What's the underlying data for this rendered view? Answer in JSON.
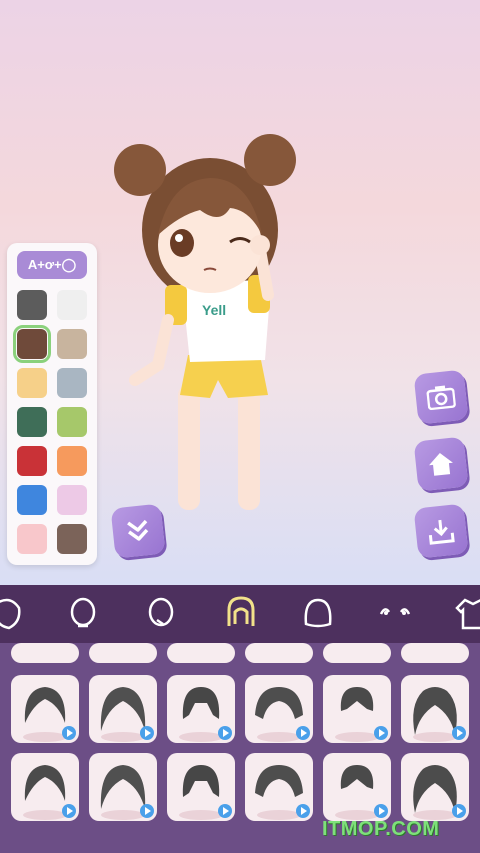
{
  "palette": {
    "header_label": "A+ơ+◯",
    "colors": [
      "#5c5c5c",
      "#efefef",
      "#6f4a3a",
      "#c8b49e",
      "#f6d089",
      "#a9b6c2",
      "#3f6e58",
      "#a6c86a",
      "#c93237",
      "#f69a5d",
      "#3f86de",
      "#edc9e6",
      "#f8c7cb",
      "#7b6359"
    ],
    "selected_index": 2
  },
  "side_buttons": [
    "camera-icon",
    "home-icon",
    "download-icon"
  ],
  "shirt_text": "Yell",
  "categories": [
    "face-icon",
    "head-icon",
    "face-outline-icon",
    "hair-icon",
    "back-hair-icon",
    "eyes-icon",
    "shirt-icon"
  ],
  "selected_category": 3,
  "hair_items_rows": 2,
  "hair_items_cols": 6,
  "watermark": "ITMOP.COM"
}
